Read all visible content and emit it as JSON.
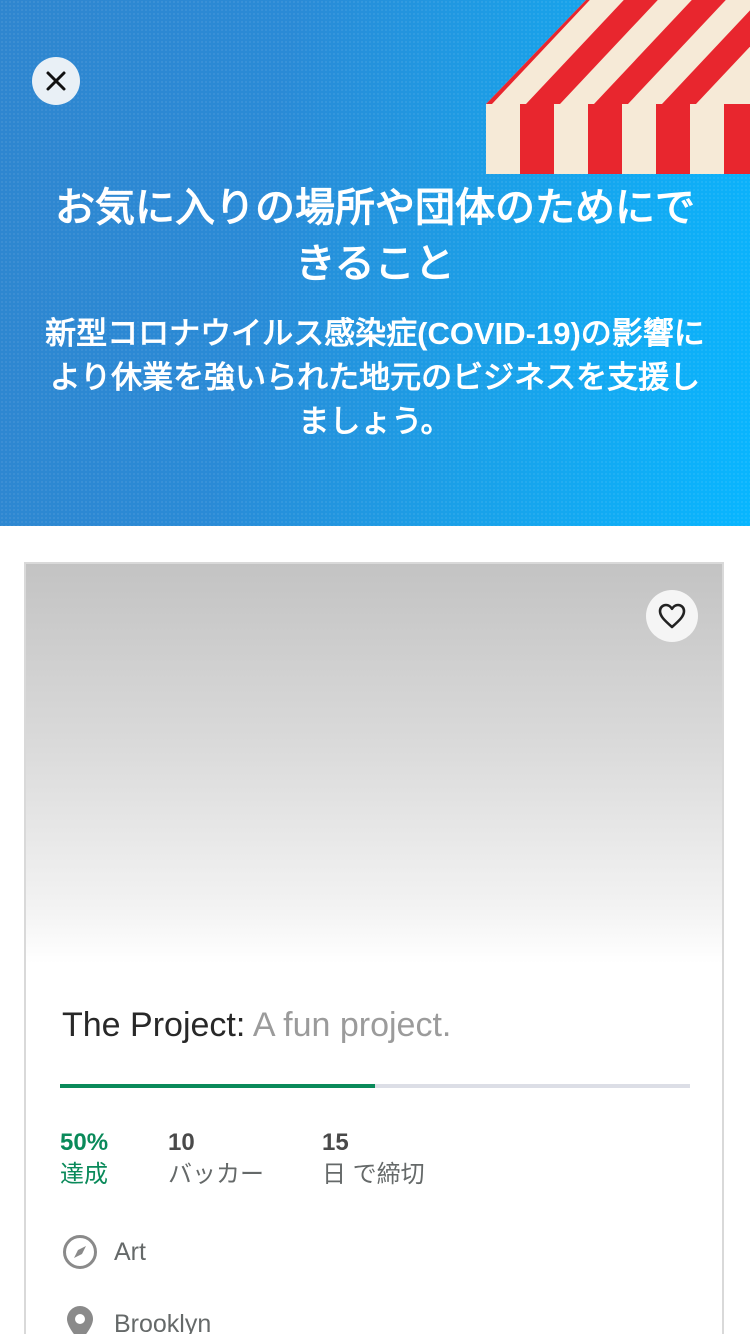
{
  "hero": {
    "title": "お気に入りの場所や団体のためにできること",
    "subtitle": "新型コロナウイルス感染症(COVID-19)の影響により休業を強いられた地元のビジネスを支援しましょう。",
    "close_icon": "close-icon",
    "colors": {
      "gradient_start": "#2f86cf",
      "gradient_end": "#08b6ff",
      "awning_red": "#e8262e",
      "awning_cream": "#f6ead7"
    }
  },
  "project": {
    "title": "The Project:",
    "blurb": "A fun project.",
    "favorite_icon": "heart-icon",
    "progress": 0.5,
    "stats": {
      "funded_value": "50%",
      "funded_label": "達成",
      "backers_value": "10",
      "backers_label": "バッカー",
      "days_value": "15",
      "days_label": "日 で締切"
    },
    "category": "Art",
    "category_icon": "compass-icon",
    "location": "Brooklyn",
    "location_icon": "location-pin-icon",
    "colors": {
      "accent": "#0a8a5a",
      "track": "#dcdee6"
    }
  }
}
